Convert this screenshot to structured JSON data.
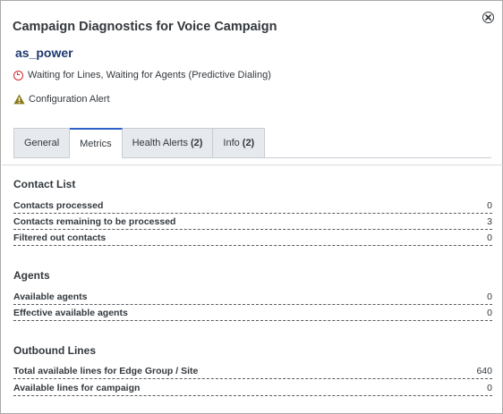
{
  "dialog": {
    "title": "Campaign Diagnostics for Voice Campaign",
    "campaign_name": "as_power",
    "status_text": "Waiting for Lines, Waiting for Agents (Predictive Dialing)",
    "alert_text": "Configuration Alert",
    "status_icon_color": "#d4262a",
    "alert_icon_color": "#8a7a1e",
    "accent_color": "#2a60c8"
  },
  "tabs": [
    {
      "label": "General",
      "count": "",
      "active": false
    },
    {
      "label": "Metrics",
      "count": "",
      "active": true
    },
    {
      "label": "Health Alerts",
      "count": "(2)",
      "active": false
    },
    {
      "label": "Info",
      "count": "(2)",
      "active": false
    }
  ],
  "sections": [
    {
      "title": "Contact List",
      "rows": [
        {
          "label": "Contacts processed",
          "value": "0"
        },
        {
          "label": "Contacts remaining to be processed",
          "value": "3"
        },
        {
          "label": "Filtered out contacts",
          "value": "0"
        }
      ]
    },
    {
      "title": "Agents",
      "rows": [
        {
          "label": "Available agents",
          "value": "0"
        },
        {
          "label": "Effective available agents",
          "value": "0"
        }
      ]
    },
    {
      "title": "Outbound Lines",
      "rows": [
        {
          "label": "Total available lines for Edge Group / Site",
          "value": "640"
        },
        {
          "label": "Available lines for campaign",
          "value": "0"
        }
      ]
    }
  ]
}
